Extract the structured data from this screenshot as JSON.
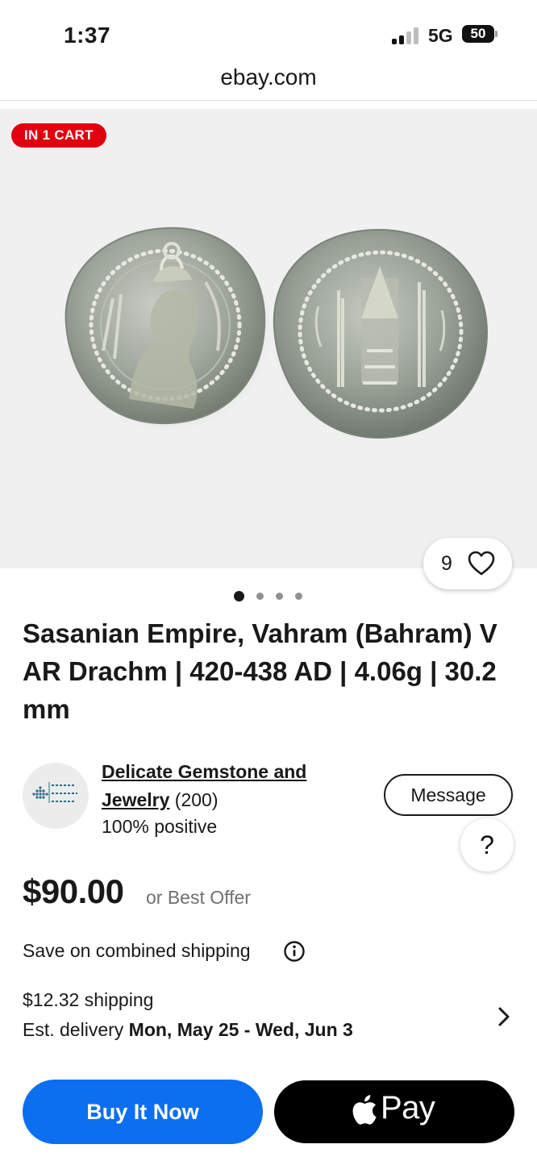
{
  "status_bar": {
    "time": "1:37",
    "network": "5G",
    "battery": "50"
  },
  "browser": {
    "url": "ebay.com"
  },
  "gallery": {
    "cart_badge": "IN 1 CART",
    "watch_count": "9",
    "image_index": 1,
    "image_total": 4
  },
  "listing": {
    "title": "Sasanian Empire, Vahram (Bahram) V AR Drachm | 420-438 AD | 4.06g | 30.2 mm"
  },
  "seller": {
    "name": "Delicate Gemstone and Jewelry",
    "feedback_count": "(200)",
    "positive": "100% positive",
    "message_label": "Message",
    "help_label": "?"
  },
  "pricing": {
    "price": "$90.00",
    "best_offer": "or Best Offer"
  },
  "shipping": {
    "combined": "Save on combined shipping",
    "cost": "$12.32 shipping",
    "delivery_prefix": "Est. delivery",
    "delivery_range": "Mon, May 25 - Wed, Jun 3"
  },
  "actions": {
    "buy_now": "Buy It Now",
    "pay": "Pay"
  },
  "colors": {
    "cart_badge": "#e0000f",
    "buy_button": "#0b6ff0",
    "image_bg": "#f0f0f0"
  }
}
